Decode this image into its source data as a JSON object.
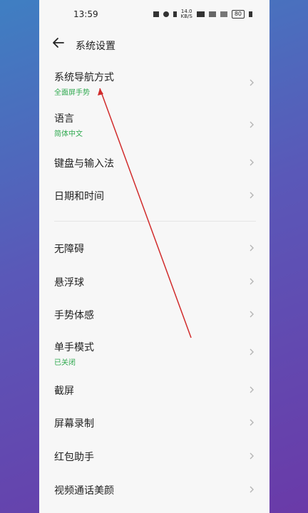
{
  "status_bar": {
    "time": "13:59",
    "network_speed_value": "14.0",
    "network_speed_unit": "KB/S",
    "battery": "80"
  },
  "header": {
    "title": "系统设置"
  },
  "settings": {
    "items": [
      {
        "label": "系统导航方式",
        "sub": "全面屏手势"
      },
      {
        "label": "语言",
        "sub": "简体中文"
      },
      {
        "label": "键盘与输入法"
      },
      {
        "label": "日期和时间"
      },
      {
        "label": "无障碍"
      },
      {
        "label": "悬浮球"
      },
      {
        "label": "手势体感"
      },
      {
        "label": "单手模式",
        "sub": "已关闭"
      },
      {
        "label": "截屏"
      },
      {
        "label": "屏幕录制"
      },
      {
        "label": "红包助手"
      },
      {
        "label": "视频通话美颜"
      }
    ]
  },
  "colors": {
    "subtitle_green": "#2fa94f",
    "annotation_red": "#d12c2c"
  }
}
